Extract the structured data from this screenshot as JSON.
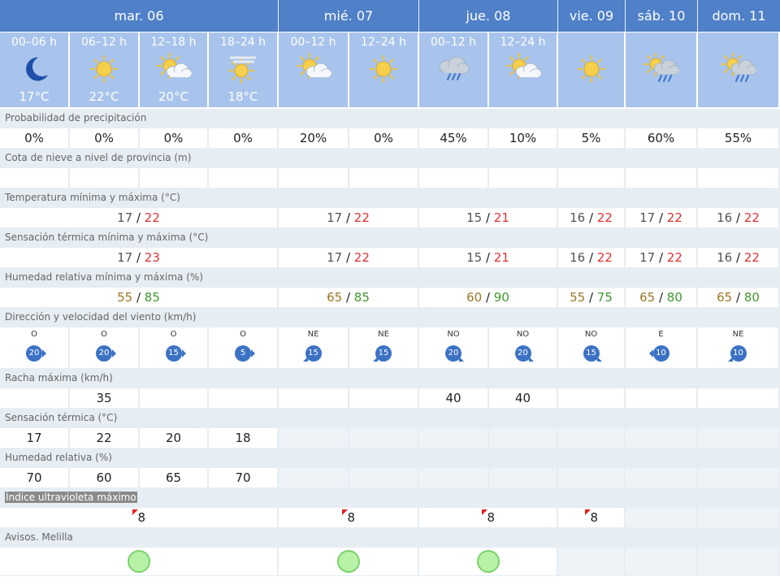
{
  "days": [
    {
      "label": "mar. 06"
    },
    {
      "label": "mié. 07"
    },
    {
      "label": "jue. 08"
    },
    {
      "label": "vie. 09"
    },
    {
      "label": "sáb. 10"
    },
    {
      "label": "dom. 11"
    }
  ],
  "periods": [
    {
      "label": "00–06 h",
      "icon": "night-moon-icon",
      "temp": "17°C"
    },
    {
      "label": "06–12 h",
      "icon": "sun-icon",
      "temp": "22°C"
    },
    {
      "label": "12–18 h",
      "icon": "sun-cloud-icon",
      "temp": "20°C"
    },
    {
      "label": "18–24 h",
      "icon": "sun-haze-icon",
      "temp": "18°C"
    },
    {
      "label": "00–12 h",
      "icon": "sun-cloud-icon",
      "temp": ""
    },
    {
      "label": "12–24 h",
      "icon": "sun-icon",
      "temp": ""
    },
    {
      "label": "00–12 h",
      "icon": "cloud-rain-icon",
      "temp": ""
    },
    {
      "label": "12–24 h",
      "icon": "sun-cloud-icon",
      "temp": ""
    },
    {
      "label": "",
      "icon": "sun-icon",
      "temp": ""
    },
    {
      "label": "",
      "icon": "sun-cloud-rain-icon",
      "temp": ""
    },
    {
      "label": "",
      "icon": "sun-cloud-rain-icon",
      "temp": ""
    }
  ],
  "labels": {
    "precip": "Probabilidad de precipitación",
    "snow": "Cota de nieve a nivel de provincia (m)",
    "temp": "Temperatura mínima y máxima (°C)",
    "feels": "Sensación térmica mínima y máxima (°C)",
    "humidity": "Humedad relativa mínima y máxima (%)",
    "wind": "Dirección y velocidad del viento (km/h)",
    "gust": "Racha máxima (km/h)",
    "feels_period": "Sensación térmica (°C)",
    "humidity_period": "Humedad relativa (%)",
    "uv": "Índice ultravioleta máximo",
    "warnings": "Avisos. Melilla"
  },
  "precip": [
    "0%",
    "0%",
    "0%",
    "0%",
    "20%",
    "0%",
    "45%",
    "10%",
    "5%",
    "60%",
    "55%"
  ],
  "temp_day": [
    {
      "min": "17",
      "max": "22"
    },
    {
      "min": "17",
      "max": "22"
    },
    {
      "min": "15",
      "max": "21"
    },
    {
      "min": "16",
      "max": "22"
    },
    {
      "min": "17",
      "max": "22"
    },
    {
      "min": "16",
      "max": "22"
    }
  ],
  "feels_day": [
    {
      "min": "17",
      "max": "23"
    },
    {
      "min": "17",
      "max": "22"
    },
    {
      "min": "15",
      "max": "21"
    },
    {
      "min": "16",
      "max": "22"
    },
    {
      "min": "17",
      "max": "22"
    },
    {
      "min": "16",
      "max": "22"
    }
  ],
  "hum_day": [
    {
      "min": "55",
      "max": "85"
    },
    {
      "min": "65",
      "max": "85"
    },
    {
      "min": "60",
      "max": "90"
    },
    {
      "min": "55",
      "max": "75"
    },
    {
      "min": "65",
      "max": "80"
    },
    {
      "min": "65",
      "max": "80"
    }
  ],
  "wind": [
    {
      "dir": "O",
      "speed": "20"
    },
    {
      "dir": "O",
      "speed": "20"
    },
    {
      "dir": "O",
      "speed": "15"
    },
    {
      "dir": "O",
      "speed": "5"
    },
    {
      "dir": "NE",
      "speed": "15"
    },
    {
      "dir": "NE",
      "speed": "15"
    },
    {
      "dir": "NO",
      "speed": "20"
    },
    {
      "dir": "NO",
      "speed": "20"
    },
    {
      "dir": "NO",
      "speed": "15"
    },
    {
      "dir": "E",
      "speed": "10"
    },
    {
      "dir": "NE",
      "speed": "10"
    }
  ],
  "gust": [
    "",
    "35",
    "",
    "",
    "",
    "",
    "40",
    "40",
    "",
    "",
    ""
  ],
  "feels_period": [
    "17",
    "22",
    "20",
    "18"
  ],
  "hum_period": [
    "70",
    "60",
    "65",
    "70"
  ],
  "uv": [
    "8",
    "8",
    "8",
    "8",
    "",
    ""
  ],
  "warnings": [
    "green",
    "green",
    "green",
    "",
    "",
    ""
  ],
  "colors": {
    "header": "#4f80c8",
    "subheader": "#a8c4ec",
    "max": "#e03030",
    "hum_min": "#9b7524",
    "hum_max": "#3f9a2e",
    "wind": "#3c72c4",
    "warning_green": "#b8f2a8"
  }
}
